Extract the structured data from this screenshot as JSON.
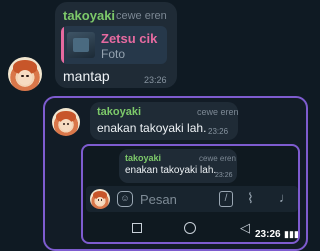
{
  "top_message": {
    "sender": "takoyaki",
    "title": "cewe eren",
    "reply_author": "Zetsu cik",
    "reply_text": "Foto",
    "text": "mantap",
    "time": "23:26"
  },
  "screenshot": {
    "outer_message": {
      "sender": "takoyaki",
      "title": "cewe eren",
      "text": "enakan takoyaki lah.",
      "time": "23:26"
    },
    "inner_message": {
      "sender": "takoyaki",
      "title": "cewe eren",
      "text": "enakan takoyaki lah.",
      "time": "23:26"
    },
    "input": {
      "placeholder": "Pesan",
      "icons": [
        "emoji-icon",
        "command-icon",
        "attach-icon",
        "mic-icon"
      ]
    },
    "nav": {
      "icons": [
        "recent-apps-icon",
        "home-icon",
        "back-icon"
      ]
    },
    "status_time": "23:26"
  },
  "colors": {
    "sender": "#7dc96a",
    "reply_author": "#e66aa0",
    "frame_border": "#7e5ccf",
    "bubble": "#1f2b36"
  }
}
